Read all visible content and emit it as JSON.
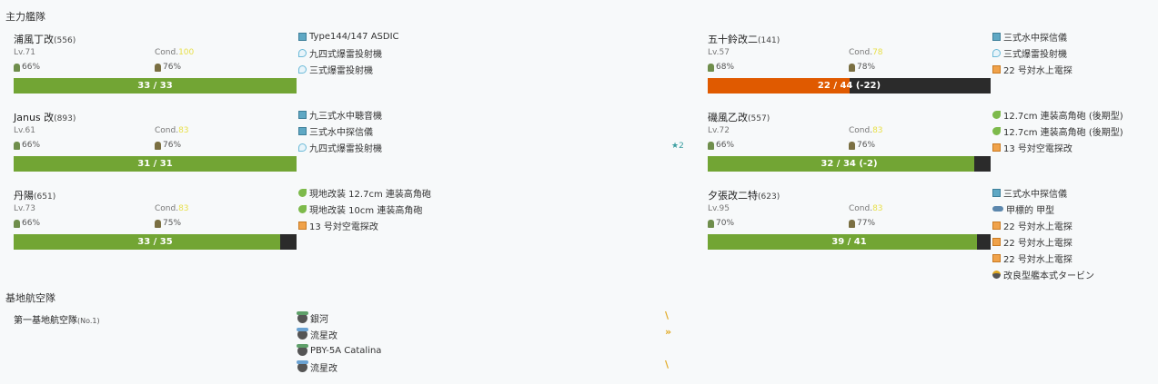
{
  "main_fleet": {
    "title": "主力艦隊",
    "ships": [
      {
        "name": "浦風丁改",
        "id": "(556)",
        "lv": "Lv.71",
        "cond_label": "Cond.",
        "cond_value": "100",
        "ammo": "66%",
        "fuel": "76%",
        "hp_text": "33 / 33",
        "hp_fraction": 1.0,
        "hp_color": "green",
        "equips": [
          {
            "icon": "sonar-icon",
            "name": "Type144/147 ASDIC"
          },
          {
            "icon": "depth-charge-icon",
            "name": "九四式爆雷投射機"
          },
          {
            "icon": "depth-charge-icon",
            "name": "三式爆雷投射機"
          }
        ]
      },
      {
        "name": "Janus 改",
        "id": "(893)",
        "lv": "Lv.61",
        "cond_label": "Cond.",
        "cond_value": "83",
        "ammo": "66%",
        "fuel": "76%",
        "hp_text": "31 / 31",
        "hp_fraction": 1.0,
        "hp_color": "green",
        "star": "★2",
        "equips": [
          {
            "icon": "sonar-icon",
            "name": "九三式水中聴音機"
          },
          {
            "icon": "sonar-icon",
            "name": "三式水中探信儀"
          },
          {
            "icon": "depth-charge-icon",
            "name": "九四式爆雷投射機"
          }
        ]
      },
      {
        "name": "丹陽",
        "id": "(651)",
        "lv": "Lv.73",
        "cond_label": "Cond.",
        "cond_value": "83",
        "ammo": "66%",
        "fuel": "75%",
        "hp_text": "33 / 35",
        "hp_fraction": 0.943,
        "hp_color": "green",
        "equips": [
          {
            "icon": "gun-icon",
            "name": "現地改装 12.7cm 連装高角砲"
          },
          {
            "icon": "gun-icon",
            "name": "現地改装 10cm 連装高角砲"
          },
          {
            "icon": "radar-icon",
            "name": "13 号対空電探改"
          }
        ]
      },
      {
        "name": "五十鈴改二",
        "id": "(141)",
        "lv": "Lv.57",
        "cond_label": "Cond.",
        "cond_value": "78",
        "ammo": "68%",
        "fuel": "78%",
        "hp_text": "22 / 44 (-22)",
        "hp_fraction": 0.5,
        "hp_color": "red",
        "equips": [
          {
            "icon": "sonar-icon",
            "name": "三式水中探信儀"
          },
          {
            "icon": "depth-charge-icon",
            "name": "三式爆雷投射機"
          },
          {
            "icon": "radar-icon",
            "name": "22 号対水上電探"
          }
        ]
      },
      {
        "name": "磯風乙改",
        "id": "(557)",
        "lv": "Lv.72",
        "cond_label": "Cond.",
        "cond_value": "83",
        "ammo": "66%",
        "fuel": "76%",
        "hp_text": "32 / 34 (-2)",
        "hp_fraction": 0.941,
        "hp_color": "green",
        "equips": [
          {
            "icon": "gun-icon",
            "name": "12.7cm 連装高角砲 (後期型)"
          },
          {
            "icon": "gun-icon",
            "name": "12.7cm 連装高角砲 (後期型)"
          },
          {
            "icon": "radar-icon",
            "name": "13 号対空電探改"
          }
        ]
      },
      {
        "name": "夕張改二特",
        "id": "(623)",
        "lv": "Lv.95",
        "cond_label": "Cond.",
        "cond_value": "83",
        "ammo": "70%",
        "fuel": "77%",
        "hp_text": "39 / 41",
        "hp_fraction": 0.951,
        "hp_color": "green",
        "equips": [
          {
            "icon": "sonar-icon",
            "name": "三式水中探信儀"
          },
          {
            "icon": "drum-icon",
            "name": "甲標的 甲型"
          },
          {
            "icon": "radar-icon",
            "name": "22 号対水上電探"
          },
          {
            "icon": "radar-icon",
            "name": "22 号対水上電探"
          },
          {
            "icon": "radar-icon",
            "name": "22 号対水上電探"
          },
          {
            "icon": "turbine-icon",
            "name": "改良型艦本式タービン"
          }
        ]
      }
    ]
  },
  "lbas": {
    "title": "基地航空隊",
    "squadron": {
      "name": "第一基地航空隊",
      "no": "(No.1)"
    },
    "planes": [
      {
        "name": "銀河",
        "prof": "\\",
        "color": "green"
      },
      {
        "name": "流星改",
        "prof": "»",
        "color": "blue"
      },
      {
        "name": "PBY-5A Catalina",
        "prof": "",
        "color": "green"
      },
      {
        "name": "流星改",
        "prof": "\\",
        "color": "blue"
      }
    ]
  },
  "colors": {
    "hp_green": "#72a534",
    "hp_red": "#e05a00",
    "hp_bg": "#2b2b2b",
    "cond_highlight": "#e8e04a"
  }
}
